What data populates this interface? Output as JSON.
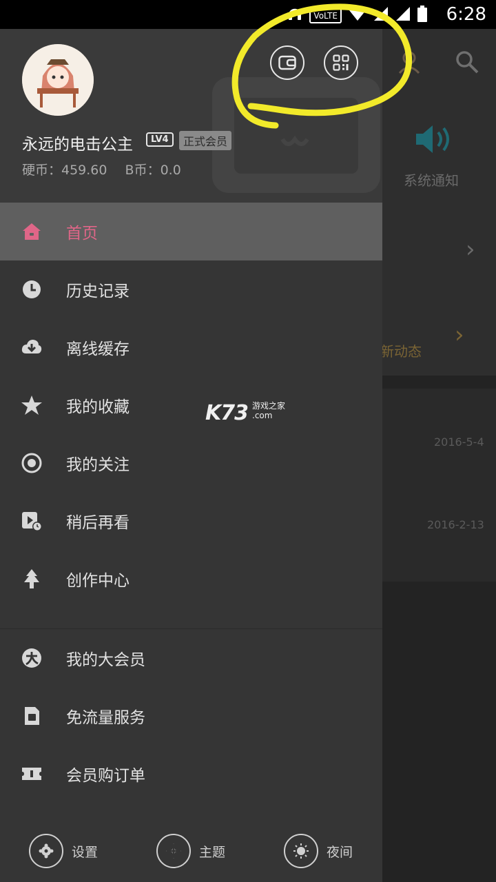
{
  "status_bar": {
    "time": "6:28",
    "network_badge": "VoLTE"
  },
  "background": {
    "notice_label": "系统通知",
    "dynamic_label": "新动态",
    "dates": [
      "2016-5-4",
      "2016-2-13"
    ]
  },
  "profile": {
    "username": "永远的电击公主",
    "level": "LV4",
    "member_tag": "正式会员",
    "coins_label": "硬币：459.60",
    "bcoins_label": "B币：0.0"
  },
  "header_buttons": {
    "wallet_icon": "wallet-icon",
    "qr_icon": "qr-code-icon"
  },
  "menu": {
    "items": [
      {
        "label": "首页",
        "icon": "home-icon",
        "active": true
      },
      {
        "label": "历史记录",
        "icon": "clock-icon"
      },
      {
        "label": "离线缓存",
        "icon": "download-cloud-icon"
      },
      {
        "label": "我的收藏",
        "icon": "star-icon"
      },
      {
        "label": "我的关注",
        "icon": "target-icon"
      },
      {
        "label": "稍后再看",
        "icon": "watch-later-icon"
      },
      {
        "label": "创作中心",
        "icon": "tree-icon"
      }
    ],
    "items2": [
      {
        "label": "我的大会员",
        "icon": "vip-icon"
      },
      {
        "label": "免流量服务",
        "icon": "sim-card-icon"
      },
      {
        "label": "会员购订单",
        "icon": "ticket-icon"
      }
    ]
  },
  "bottom_bar": {
    "settings": "设置",
    "theme": "主题",
    "night": "夜间"
  },
  "watermark": {
    "main": "K73",
    "sub": "游戏之家",
    "com": ".com"
  },
  "colors": {
    "accent": "#e06688",
    "annotation": "#f2ea2a"
  }
}
